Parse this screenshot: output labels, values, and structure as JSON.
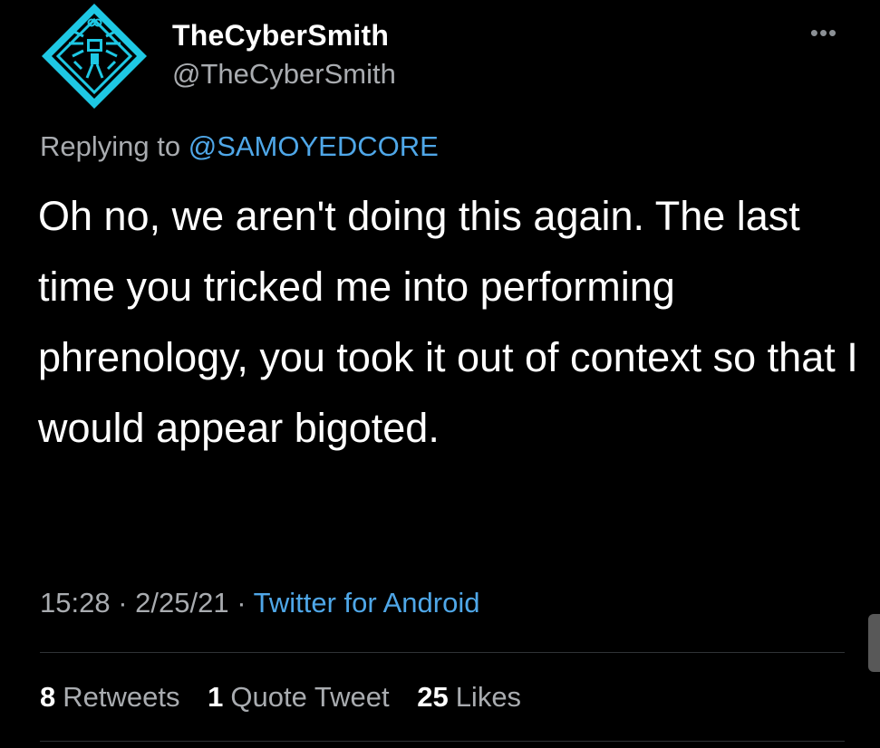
{
  "author": {
    "display_name": "TheCyberSmith",
    "handle": "@TheCyberSmith",
    "avatar_icon": "robot-diamond-logo-icon",
    "avatar_color": "#1ec8e4"
  },
  "more_icon": "more-horizontal-icon",
  "more_glyph": "•••",
  "reply": {
    "prefix": "Replying to ",
    "mention": "@SAMOYEDCORE"
  },
  "tweet_text": "Oh no, we aren't doing this again. The last time you tricked me into performing phrenology, you took it out of context so that I would appear bigoted.",
  "meta": {
    "time": "15:28",
    "date": "2/25/21",
    "separator": "·",
    "source": "Twitter for Android"
  },
  "stats": {
    "retweets_count": "8",
    "retweets_label": "Retweets",
    "quotes_count": "1",
    "quotes_label": "Quote Tweet",
    "likes_count": "25",
    "likes_label": "Likes"
  },
  "colors": {
    "background": "#000000",
    "link": "#4fa7e8",
    "secondary_text": "#a9acb0",
    "primary_text": "#ffffff"
  }
}
